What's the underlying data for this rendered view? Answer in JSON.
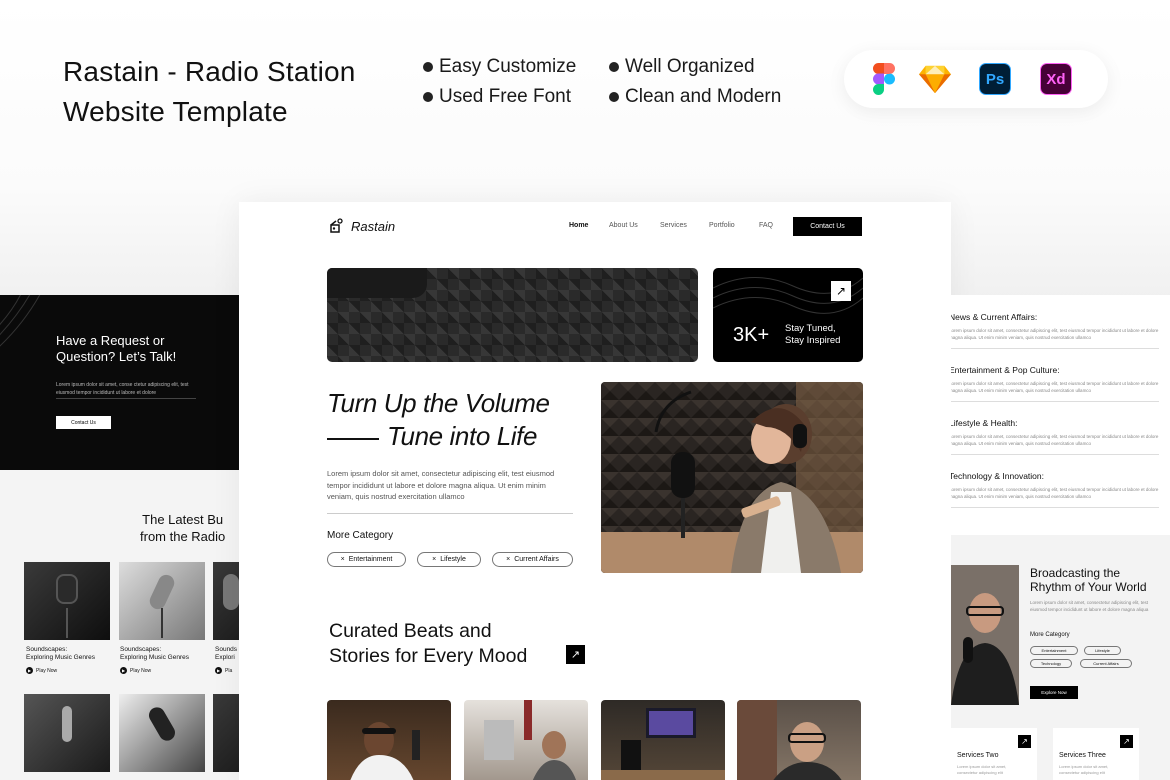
{
  "banner": {
    "title_line1": "Rastain - Radio Station",
    "title_line2": "Website Template",
    "features": [
      "Easy Customize",
      "Used Free Font",
      "Well Organized",
      "Clean and Modern"
    ],
    "tools": [
      "figma-icon",
      "sketch-icon",
      "photoshop-icon",
      "xd-icon"
    ],
    "ps_label": "Ps",
    "xd_label": "Xd"
  },
  "site": {
    "brand": "Rastain",
    "nav": [
      "Home",
      "About Us",
      "Services",
      "Portfolio",
      "FAQ"
    ],
    "contact_label": "Contact Us",
    "stat_number": "3K+",
    "stat_caption_line1": "Stay Tuned,",
    "stat_caption_line2": "Stay Inspired",
    "headline_line1": "Turn Up the Volume",
    "headline_line2": "Tune into Life",
    "body": "Lorem ipsum dolor sit amet, consectetur adipiscing elit, test eiusmod tempor incididunt ut labore et dolore magna aliqua. Ut enim minim veniam, quis nostrud exercitation ullamco",
    "more_category": "More Category",
    "categories": [
      "Entertainment",
      "Lifestyle",
      "Current Affairs"
    ],
    "curated_line1": "Curated Beats and",
    "curated_line2": "Stories for Every Mood"
  },
  "left_preview": {
    "question_line1": "Have a Request or",
    "question_line2": "Question? Let’s Talk!",
    "text": "Lorem ipsum dolor sit amet, conse ctetur adipiscing elit, test eiusmod tempor incididunt ut labore et dolore",
    "button": "Contact Us",
    "latest_line1": "The Latest Bu",
    "latest_line2": "from the Radio",
    "cards": [
      {
        "title_line1": "Soundscapes:",
        "title_line2": "Exploring Music Genres",
        "play": "Play Now"
      },
      {
        "title_line1": "Soundscapes:",
        "title_line2": "Exploring Music Genres",
        "play": "Play Now"
      },
      {
        "title_line1": "Sounds",
        "title_line2": "Explori",
        "play": "Pla"
      }
    ]
  },
  "right_preview": {
    "news": [
      {
        "title": "News & Current Affairs:",
        "text": "Lorem ipsum dolor sit amet, consectetur adipiscing elit, test eiusmod tempor incididunt ut labore et dolore magna aliqua. Ut enim minim veniam, quis nostrud exercitation ullamco"
      },
      {
        "title": "Entertainment & Pop Culture:",
        "text": "Lorem ipsum dolor sit amet, consectetur adipiscing elit, test eiusmod tempor incididunt ut labore et dolore magna aliqua. Ut enim minim veniam, quis nostrud exercitation ullamco"
      },
      {
        "title": "Lifestyle & Health:",
        "text": "Lorem ipsum dolor sit amet, consectetur adipiscing elit, test eiusmod tempor incididunt ut labore et dolore magna aliqua. Ut enim minim veniam, quis nostrud exercitation ullamco"
      },
      {
        "title": "Technology & Innovation:",
        "text": "Lorem ipsum dolor sit amet, consectetur adipiscing elit, test eiusmod tempor incididunt ut labore et dolore magna aliqua. Ut enim minim veniam, quis nostrud exercitation ullamco"
      }
    ],
    "broadcast_line1": "Broadcasting the",
    "broadcast_line2": "Rhythm of Your World",
    "broadcast_text": "Lorem ipsum dolor sit amet, consectetur adipiscing elit, test eiusmod tempor incididunt ut labore et dolore magna aliqua",
    "more_category": "More Category",
    "chips": [
      "Entertainment",
      "Lifestyle",
      "Technology",
      "Current Affairs"
    ],
    "explore": "Explore Now",
    "services": [
      {
        "name": "Services Two",
        "text": "Lorem ipsum dolor sit amet, consectetur adipiscing elit"
      },
      {
        "name": "Services Three",
        "text": "Lorem ipsum dolor sit amet, consectetur adipiscing elit"
      }
    ]
  }
}
